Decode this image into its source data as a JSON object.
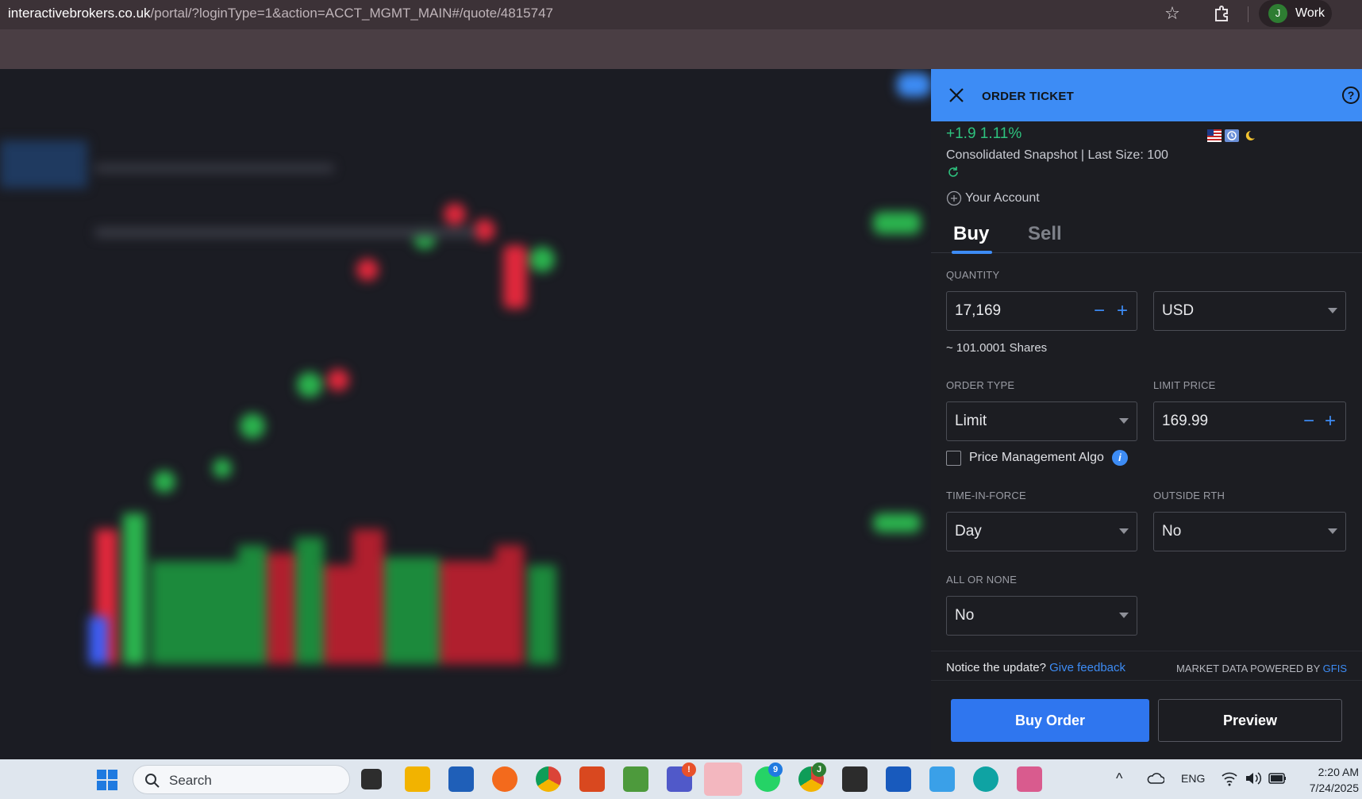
{
  "browser": {
    "url_host": "interactivebrokers.co.uk",
    "url_path": "/portal/?loginType=1&action=ACCT_MGMT_MAIN#/quote/4815747",
    "profile_initial": "J",
    "profile_name": "Work"
  },
  "ticket": {
    "title": "ORDER TICKET",
    "help_glyph": "?",
    "change": "+1.9 1.11%",
    "snapshot": "Consolidated Snapshot | Last Size: 100",
    "account_label": "Your Account",
    "tabs": {
      "buy": "Buy",
      "sell": "Sell",
      "active": "Buy"
    },
    "quantity": {
      "label": "QUANTITY",
      "value": "17,169",
      "currency": "USD",
      "shares_estimate": "~ 101.0001 Shares"
    },
    "order_type": {
      "label": "ORDER TYPE",
      "value": "Limit"
    },
    "limit_price": {
      "label": "LIMIT PRICE",
      "value": "169.99"
    },
    "price_algo": {
      "label": "Price Management Algo",
      "checked": false,
      "info_glyph": "i"
    },
    "time_in_force": {
      "label": "TIME-IN-FORCE",
      "value": "Day"
    },
    "outside_rth": {
      "label": "OUTSIDE RTH",
      "value": "No"
    },
    "all_or_none": {
      "label": "ALL OR NONE",
      "value": "No"
    },
    "notice": {
      "text": "Notice the update?",
      "link": "Give feedback"
    },
    "powered": {
      "text": "MARKET DATA POWERED BY",
      "link": "GFIS"
    },
    "buttons": {
      "buy_order": "Buy Order",
      "preview": "Preview"
    },
    "stepper": {
      "minus": "−",
      "plus": "+"
    },
    "colors": {
      "accent": "#3d8cf5",
      "positive": "#2ec27e",
      "header": "#3d8cf5"
    }
  },
  "taskbar": {
    "search_placeholder": "Search",
    "apps": [
      "task-view",
      "file-explorer",
      "microsoft-store",
      "firefox",
      "chrome",
      "remote-desktop",
      "green-app",
      "teams",
      "clock-app",
      "whatsapp",
      "chrome-profile",
      "terminal",
      "word",
      "photos",
      "edge",
      "snipping-tool"
    ],
    "badges": {
      "teams": "!",
      "whatsapp": "9",
      "chrome_profile": "J"
    },
    "tray": {
      "language": "ENG"
    },
    "clock": {
      "time": "2:20 AM",
      "date": "7/24/2025"
    }
  }
}
